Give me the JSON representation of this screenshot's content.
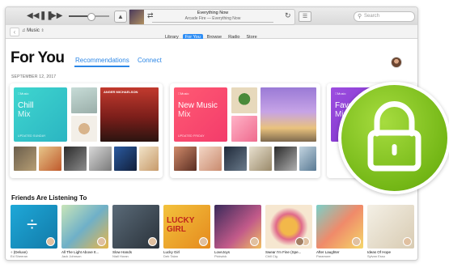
{
  "colors": {
    "accent": "#2f8ef5",
    "lock_green": "#76b81a"
  },
  "titlebar": {
    "rewind_icon": "rewind-icon",
    "pause_icon": "pause-icon",
    "forward_icon": "fast-forward-icon",
    "volume_level": 0.55,
    "now_playing": {
      "title": "Everything Now",
      "subtitle": "Arcade Fire — Everything Now"
    },
    "search_placeholder": "Search"
  },
  "navbar": {
    "media_selector": "Music",
    "tabs": [
      {
        "label": "Library",
        "active": false
      },
      {
        "label": "For You",
        "active": true
      },
      {
        "label": "Browse",
        "active": false
      },
      {
        "label": "Radio",
        "active": false
      },
      {
        "label": "Store",
        "active": false
      }
    ]
  },
  "page": {
    "title": "For You",
    "segments": [
      "Recommendations",
      "Connect"
    ],
    "date": "SEPTEMBER 12, 2017"
  },
  "mixes": [
    {
      "logo": "Music",
      "name": "Chill",
      "mix": "Mix",
      "updated": "UPDATED SUNDAY",
      "top_tile_title": "ANGER MICHAELSON"
    },
    {
      "logo": "Music",
      "name": "New Music",
      "mix": "Mix",
      "updated": "UPDATED FRIDAY"
    },
    {
      "logo": "Music",
      "name": "Favo",
      "mix": "Mix",
      "updated": ""
    }
  ],
  "friends": {
    "title": "Friends Are Listening To",
    "items": [
      {
        "album": "÷ (Deluxe)",
        "artist": "Ed Sheeran"
      },
      {
        "album": "All The Light Above It...",
        "artist": "Jack Johnson"
      },
      {
        "album": "Slow Hands",
        "artist": "Niall Horan"
      },
      {
        "album": "Lucky Girl",
        "artist": "Deb Talan"
      },
      {
        "album": "LoveJoys",
        "artist": "Pickwick"
      },
      {
        "album": "Swear I'm Fine (Spe...",
        "artist": "Chill Cig"
      },
      {
        "album": "After Laughter",
        "artist": "Paramore"
      },
      {
        "album": "Ideas Of Hope",
        "artist": "Sylvan Esso"
      }
    ]
  },
  "lock_icon": "lock-icon"
}
